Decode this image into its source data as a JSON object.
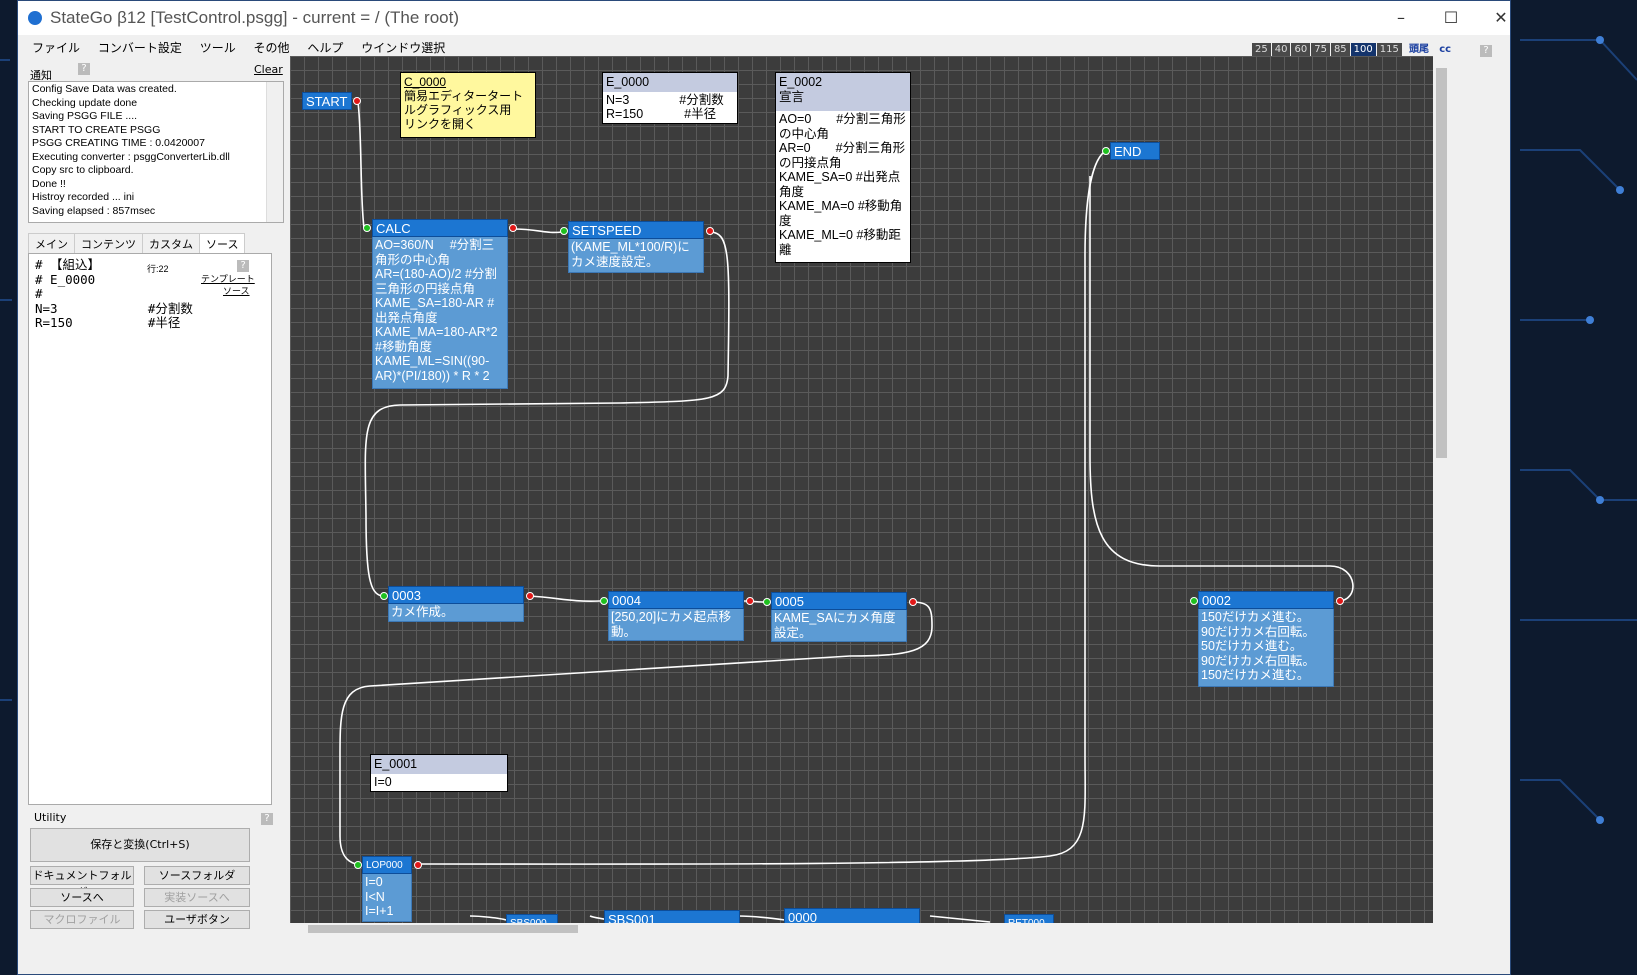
{
  "window": {
    "title": "StateGo β12   [TestControl.psgg] - current = / (The root)"
  },
  "menu": [
    "ファイル",
    "コンバート設定",
    "ツール",
    "その他",
    "ヘルプ",
    "ウインドウ選択"
  ],
  "zoom": {
    "levels": [
      "25",
      "40",
      "60",
      "75",
      "85",
      "100",
      "115"
    ],
    "selected": "100",
    "head_link": "頭尾",
    "cc_link": "cc"
  },
  "notify": {
    "label": "通知",
    "clear": "Clear",
    "log": [
      "Config Save Data was created.",
      "Checking update  done",
      "Saving PSGG FILE ....",
      "START TO CREATE PSGG",
      "PSGG CREATING TIME : 0.0420007",
      "Executing converter : psggConverterLib.dll",
      "Copy src to clipboard.",
      "Done !!",
      "Histroy recorded ... ini",
      "Saving elapsed : 857msec"
    ]
  },
  "tabs": [
    "メイン",
    "コンテンツ",
    "カスタム",
    "ソース"
  ],
  "active_tab": "ソース",
  "source": {
    "text": "# 【組込】\n# E_0000\n#\nN=3            #分割数\nR=150          #半径",
    "line_info": "行:22",
    "template_link": "テンプレート",
    "source_link": "ソース"
  },
  "utility": {
    "label": "Utility",
    "save_convert": "保存と変換(Ctrl+S)",
    "doc_folder": "ドキュメントフォルダ",
    "src_folder": "ソースフォルダ",
    "to_source": "ソースへ",
    "to_impl_source": "実装ソースへ",
    "macro_file": "マクロファイル",
    "user_button": "ユーザボタン"
  },
  "help_q": "?",
  "canvas": {
    "states": {
      "start": {
        "title": "START"
      },
      "end": {
        "title": "END"
      },
      "calc": {
        "title": "CALC",
        "body": "AO=360/N　 #分割三角形の中心角\nAR=(180-AO)/2 #分割三角形の円接点角\nKAME_SA=180-AR #出発点角度\nKAME_MA=180-AR*2 #移動角度\nKAME_ML=SIN((90-AR)*(PI/180)) * R * 2"
      },
      "setspeed": {
        "title": "SETSPEED",
        "body": "(KAME_ML*100/R)にカメ速度設定。"
      },
      "s0003": {
        "title": "0003",
        "body": "カメ作成。"
      },
      "s0004": {
        "title": "0004",
        "body": "[250,20]にカメ起点移動。"
      },
      "s0005": {
        "title": "0005",
        "body": "KAME_SAにカメ角度設定。"
      },
      "s0002": {
        "title": "0002",
        "body": "150だけカメ進む。\n90だけカメ右回転。\n50だけカメ進む。\n90だけカメ右回転。\n150だけカメ進む。"
      },
      "lop000": {
        "title": "LOP000",
        "body": "I=0\nI<N\nI=I+1"
      },
      "sbs000": {
        "title": "SBS000"
      },
      "sbs001": {
        "title": "SBS001"
      },
      "s0000": {
        "title": "0000"
      },
      "ret000": {
        "title": "RET000"
      }
    },
    "comments": {
      "c0000": {
        "title": "C_0000",
        "body": "簡易エディタータートルグラフィックス用\nリンクを開く"
      },
      "e0000": {
        "title": "E_0000",
        "body": "N=3　　　　#分割数\nR=150　　　 #半径"
      },
      "e0002": {
        "title": "E_0002",
        "sub": "宣言",
        "body": "AO=0　　#分割三角形の中心角\nAR=0　　#分割三角形の円接点角\nKAME_SA=0 #出発点角度\nKAME_MA=0 #移動角度\nKAME_ML=0 #移動距離"
      },
      "e0001": {
        "title": "E_0001",
        "body": "I=0"
      }
    }
  }
}
